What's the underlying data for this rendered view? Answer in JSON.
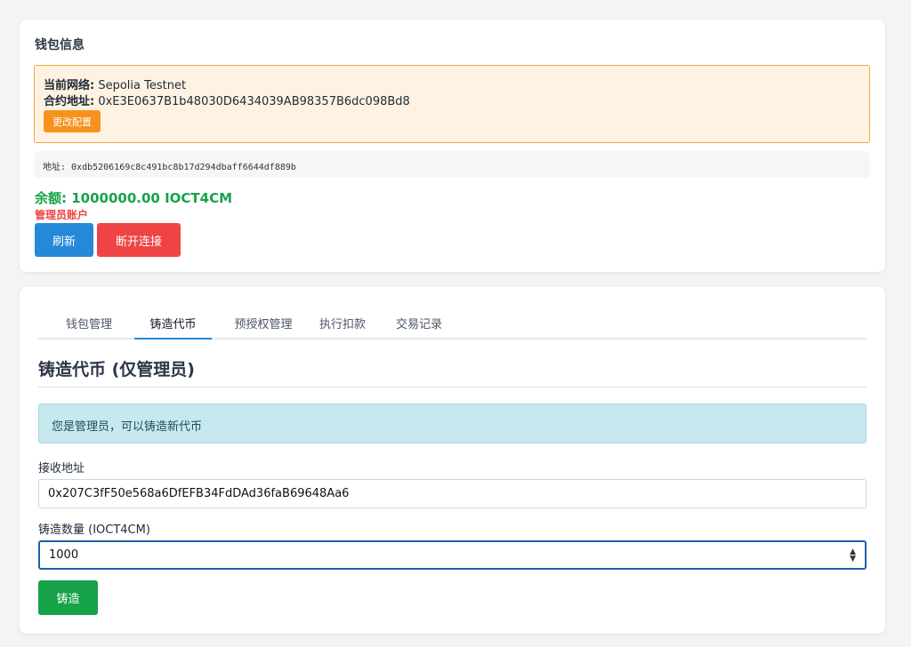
{
  "wallet": {
    "title": "钱包信息",
    "network_label": "当前网络:",
    "network_value": "Sepolia Testnet",
    "contract_label": "合约地址:",
    "contract_value": "0xE3E0637B1b48030D6434039AB98357B6dc098Bd8",
    "change_config_label": "更改配置",
    "address_text": "地址: 0xdb5206169c8c491bc8b17d294dbaff6644df889b",
    "balance_text": "余额: 1000000.00 IOCT4CM",
    "admin_text": "管理员账户",
    "refresh_label": "刷新",
    "disconnect_label": "断开连接"
  },
  "tabs": [
    {
      "label": "钱包管理",
      "active": false
    },
    {
      "label": "铸造代币",
      "active": true
    },
    {
      "label": "预授权管理",
      "active": false
    },
    {
      "label": "执行扣款",
      "active": false
    },
    {
      "label": "交易记录",
      "active": false
    }
  ],
  "mint": {
    "title": "铸造代币 (仅管理员)",
    "info_text": "您是管理员，可以铸造新代币",
    "recipient_label": "接收地址",
    "recipient_value": "0x207C3fF50e568a6DfEFB34FdDAd36faB69648Aa6",
    "amount_label": "铸造数量 (IOCT4CM)",
    "amount_value": "1000",
    "mint_button_label": "铸造"
  },
  "colors": {
    "primary_blue": "#2588d8",
    "danger_red": "#ef4444",
    "success_green": "#16a34a",
    "warning_orange": "#f7921e"
  }
}
